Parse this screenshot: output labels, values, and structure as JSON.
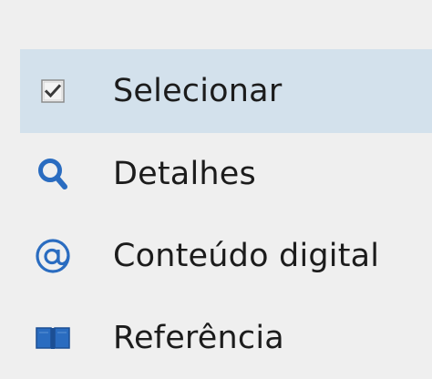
{
  "menu": {
    "items": [
      {
        "label": "Selecionar",
        "icon": "checkbox-icon",
        "selected": true
      },
      {
        "label": "Detalhes",
        "icon": "magnifier-icon",
        "selected": false
      },
      {
        "label": "Conteúdo digital",
        "icon": "at-sign-icon",
        "selected": false
      },
      {
        "label": "Referência",
        "icon": "open-book-icon",
        "selected": false
      }
    ]
  },
  "colors": {
    "background": "#efefef",
    "selected_background": "#d3e1ec",
    "icon_blue": "#2a6cc0",
    "text": "#1c1c1c"
  }
}
